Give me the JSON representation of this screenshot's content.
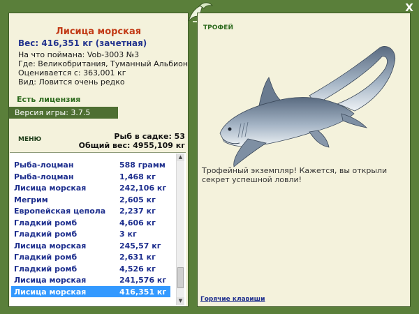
{
  "window": {
    "close_label": "X"
  },
  "catch": {
    "title": "Лисица морская",
    "weight_line": "Вес: 416,351 кг (зачетная)",
    "bait_line": "На что поймана: Vob-3003 №3",
    "location_line": "Где: Великобритания, Туманный Альбион",
    "value_line": "Оценивается с: 363,001 кг",
    "rarity_line": "Вид: Ловится очень редко"
  },
  "licence": "Есть лицензия",
  "version": "Версия игры: 3.7.5",
  "menu_label": "МЕНЮ",
  "stats": {
    "fish_count": "Рыб в садке: 53",
    "total_weight": "Общий вес: 4955,109 кг"
  },
  "fish_list": [
    {
      "name": "Рыба-лоцман",
      "weight": "588 грамм"
    },
    {
      "name": "Рыба-лоцман",
      "weight": "1,468 кг"
    },
    {
      "name": "Лисица морская",
      "weight": "242,106 кг"
    },
    {
      "name": "Мегрим",
      "weight": "2,605 кг"
    },
    {
      "name": "Европейская цепола",
      "weight": "2,237 кг"
    },
    {
      "name": "Гладкий ромб",
      "weight": "4,606 кг"
    },
    {
      "name": "Гладкий ромб",
      "weight": "3 кг"
    },
    {
      "name": "Лисица морская",
      "weight": "245,57 кг"
    },
    {
      "name": "Гладкий ромб",
      "weight": "2,631 кг"
    },
    {
      "name": "Гладкий ромб",
      "weight": "4,526 кг"
    },
    {
      "name": "Лисица морская",
      "weight": "241,576 кг"
    },
    {
      "name": "Лисица морская",
      "weight": "416,351 кг",
      "selected": true
    }
  ],
  "trophy": {
    "label": "ТРОФЕЙ",
    "text": "Трофейный экземпляр! Кажется, вы открыли секрет успешной ловли!"
  },
  "hotkeys": "Горячие клавиши",
  "colors": {
    "frame": "#5a7f3a",
    "panel": "#f4f2dc",
    "title": "#c23b17",
    "accent_blue": "#23348e",
    "selection": "#3399ff"
  }
}
